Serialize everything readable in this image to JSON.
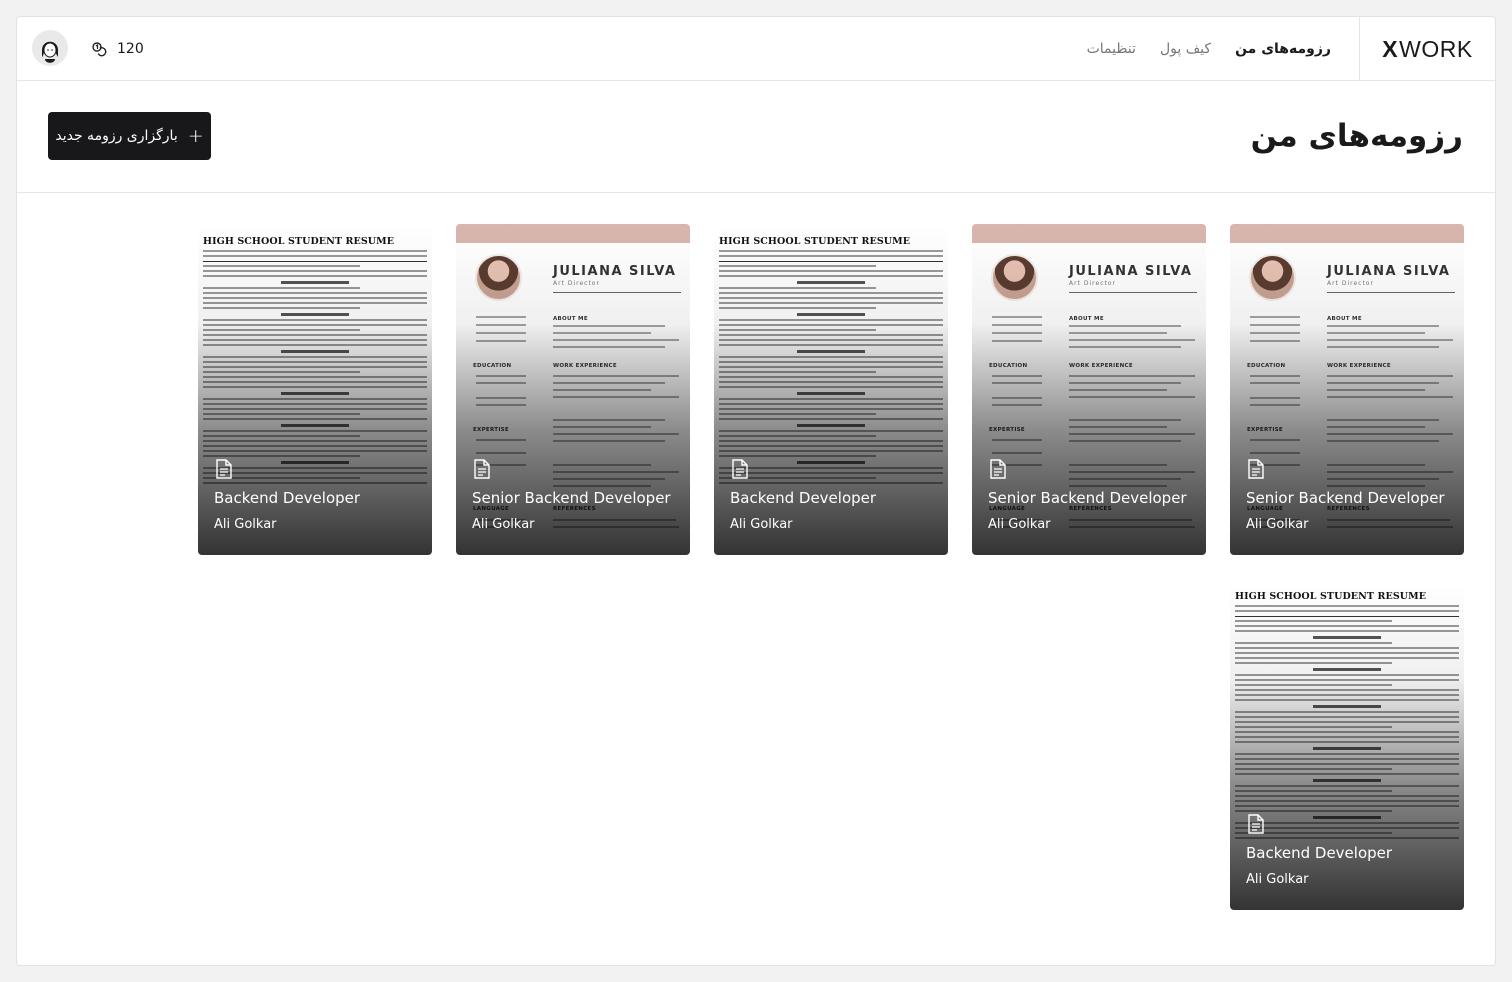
{
  "brand": {
    "logo_x": "X",
    "logo_word": "WORK"
  },
  "nav": {
    "items": [
      {
        "label": "رزومه‌های من",
        "active": true
      },
      {
        "label": "کیف پول",
        "active": false
      },
      {
        "label": "تنظیمات",
        "active": false
      }
    ]
  },
  "account": {
    "credits": "120",
    "credit_icon": "coins-icon",
    "avatar_icon": "user-avatar"
  },
  "page": {
    "title": "رزومه‌های من",
    "upload_label": "بارگزاری رزومه جدید",
    "upload_icon": "plus-icon"
  },
  "previews": {
    "student": {
      "heading": "HIGH SCHOOL STUDENT RESUME"
    },
    "designer": {
      "name": "JULIANA SILVA",
      "role": "Art Director",
      "about": "ABOUT ME",
      "education": "EDUCATION",
      "work": "WORK EXPERIENCE",
      "expertise": "EXPERTISE",
      "language": "LANGUAGE",
      "references": "REFERENCES"
    }
  },
  "cards": [
    {
      "title": "Senior Backend Developer",
      "owner": "Ali Golkar",
      "template": "designer",
      "icon": "document-icon"
    },
    {
      "title": "Senior Backend Developer",
      "owner": "Ali Golkar",
      "template": "designer",
      "icon": "document-icon"
    },
    {
      "title": "Backend Developer",
      "owner": "Ali Golkar",
      "template": "student",
      "icon": "document-icon"
    },
    {
      "title": "Senior Backend Developer",
      "owner": "Ali Golkar",
      "template": "designer",
      "icon": "document-icon"
    },
    {
      "title": "Backend Developer",
      "owner": "Ali Golkar",
      "template": "student",
      "icon": "document-icon"
    },
    {
      "title": "Backend Developer",
      "owner": "Ali Golkar",
      "template": "student",
      "icon": "document-icon"
    }
  ],
  "colors": {
    "accent": "#18181b",
    "band": "#d9b6ad",
    "background": "#f2f2f2"
  }
}
